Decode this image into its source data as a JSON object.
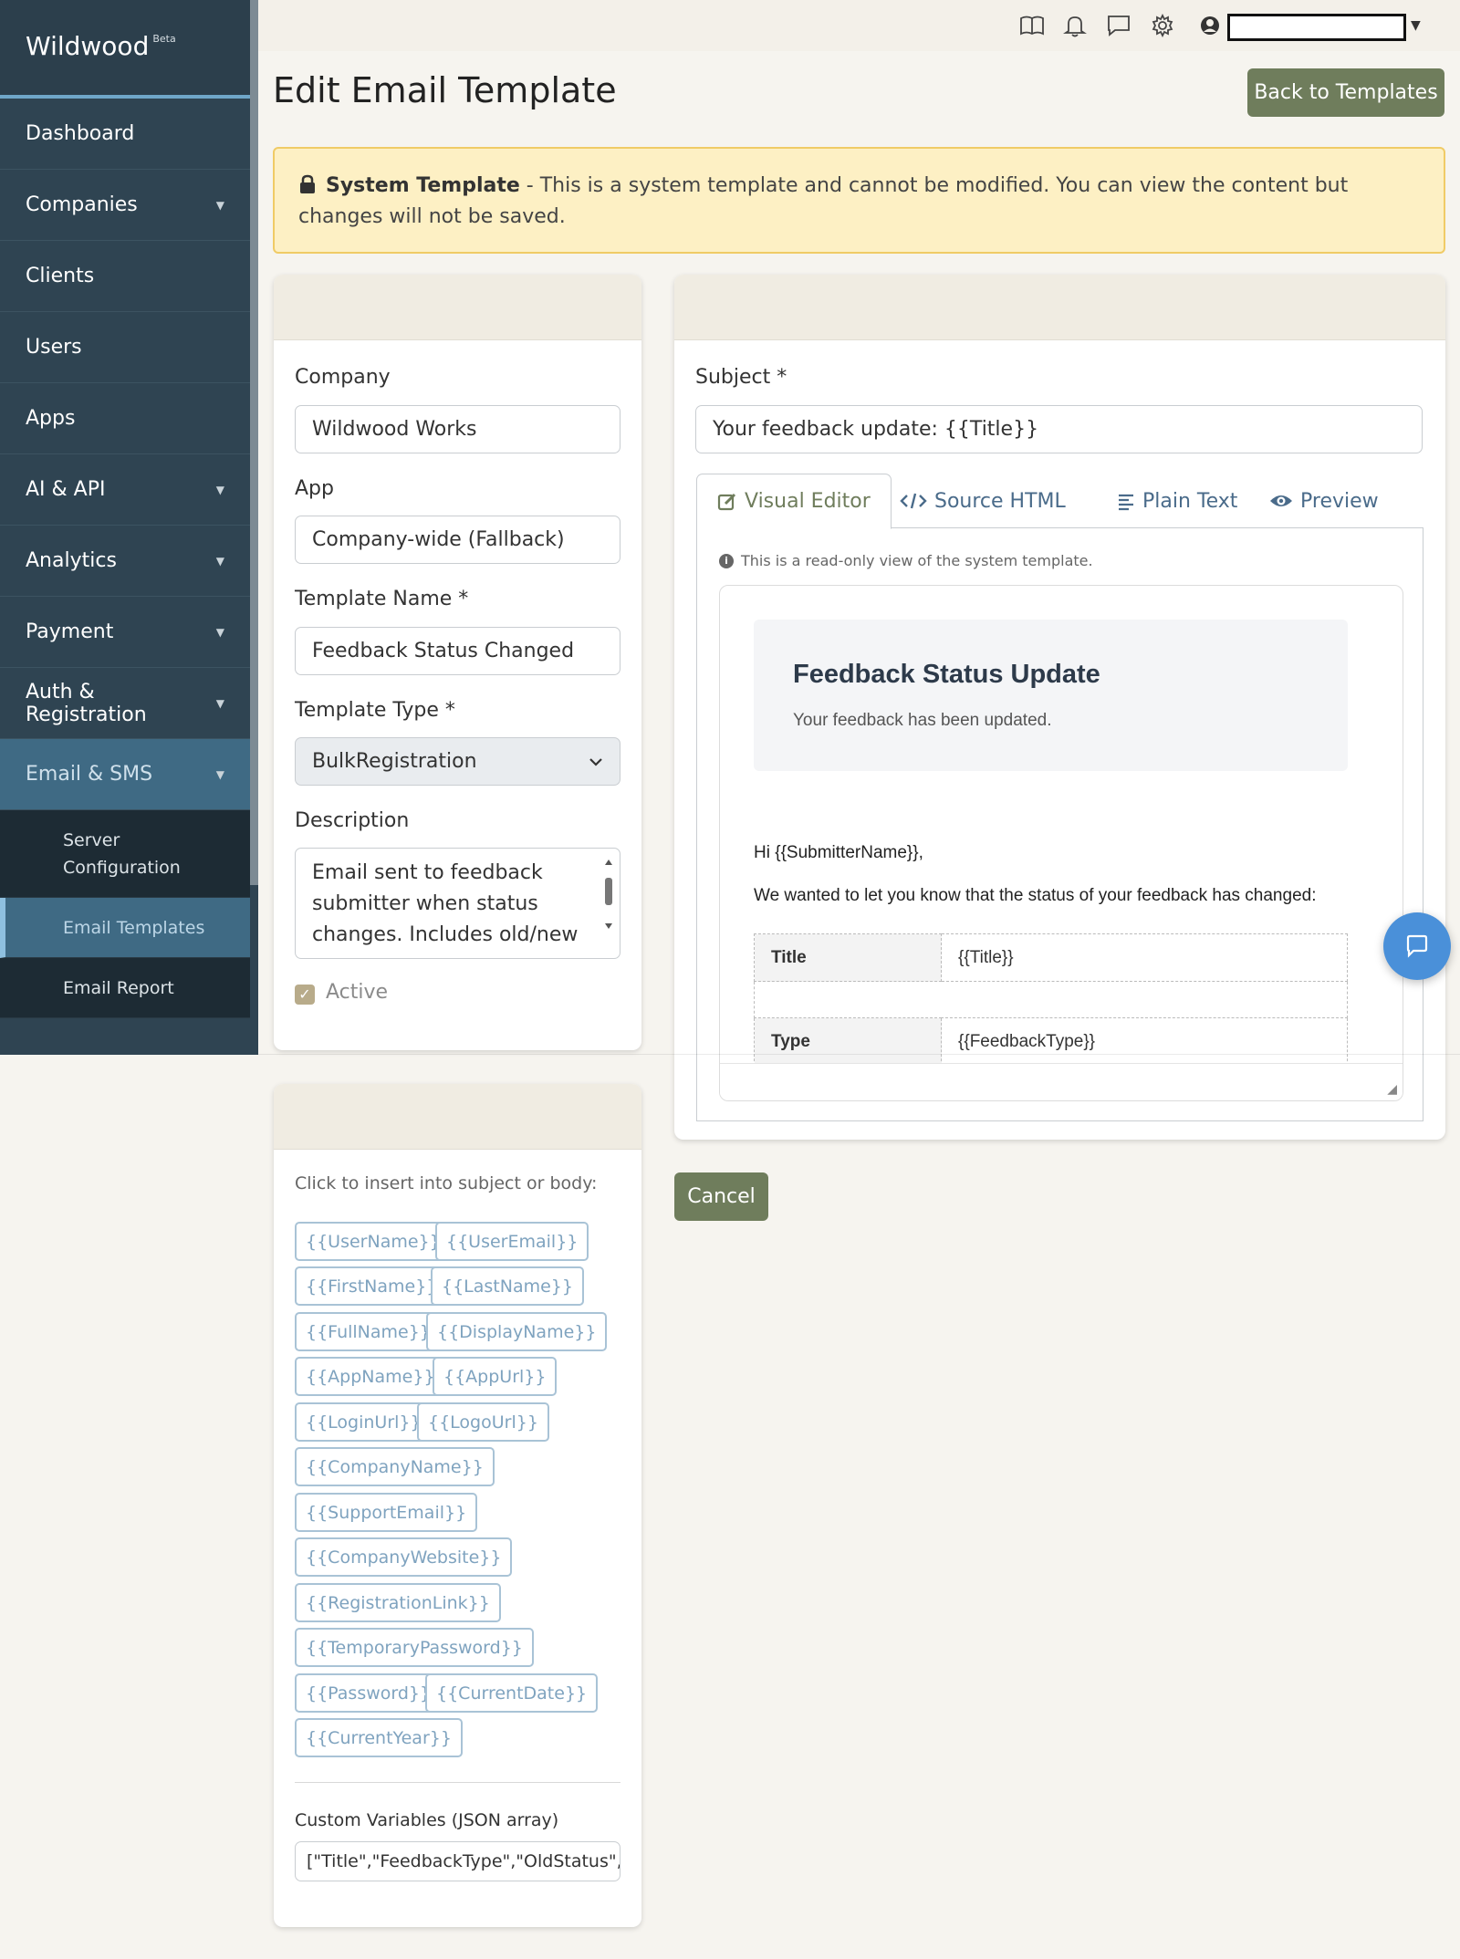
{
  "brand": {
    "name": "Wildwood",
    "badge": "Beta"
  },
  "sidebar": {
    "items": [
      {
        "label": "Dashboard",
        "has_caret": false
      },
      {
        "label": "Companies",
        "has_caret": true
      },
      {
        "label": "Clients",
        "has_caret": false
      },
      {
        "label": "Users",
        "has_caret": false
      },
      {
        "label": "Apps",
        "has_caret": false
      },
      {
        "label": "AI & API",
        "has_caret": true
      },
      {
        "label": "Analytics",
        "has_caret": true
      },
      {
        "label": "Payment",
        "has_caret": true
      },
      {
        "label": "Auth & Registration",
        "has_caret": true
      },
      {
        "label": "Email & SMS",
        "has_caret": true,
        "active": true
      }
    ],
    "subitems": [
      {
        "label": "Server Configuration"
      },
      {
        "label": "Email Templates",
        "active": true
      },
      {
        "label": "Email Report"
      }
    ]
  },
  "topbar": {
    "icons": [
      "book-icon",
      "bell-icon",
      "chat-icon",
      "gear-icon",
      "user-circle-icon"
    ],
    "user_name": ""
  },
  "page": {
    "title": "Edit Email Template",
    "back_button": "Back to Templates"
  },
  "alert": {
    "bold": "System Template",
    "text": " - This is a system template and cannot be modified. You can view the content but changes will not be saved."
  },
  "form": {
    "company_label": "Company",
    "company_value": "Wildwood Works",
    "app_label": "App",
    "app_value": "Company-wide (Fallback)",
    "name_label": "Template Name *",
    "name_value": "Feedback Status Changed",
    "type_label": "Template Type *",
    "type_value": "BulkRegistration",
    "description_label": "Description",
    "description_value": "Email sent to feedback submitter when status changes. Includes old/new",
    "active_label": "Active",
    "active_checked": true
  },
  "editor": {
    "subject_label": "Subject *",
    "subject_value": "Your feedback update: {{Title}}",
    "tabs": [
      "Visual Editor",
      "Source HTML",
      "Plain Text",
      "Preview"
    ],
    "active_tab": "Visual Editor",
    "readonly_note": "This is a read-only view of the system template.",
    "email": {
      "header_title": "Feedback Status Update",
      "header_subtitle": "Your feedback has been updated.",
      "greeting": "Hi {{SubmitterName}},",
      "intro": "We wanted to let you know that the status of your feedback has changed:",
      "rows": [
        {
          "key": "Title",
          "value": "{{Title}}"
        },
        {
          "key": "Type",
          "value": "{{FeedbackType}}"
        }
      ]
    },
    "cancel_button": "Cancel"
  },
  "variables": {
    "hint": "Click to insert into subject or body:",
    "chips": [
      "{{UserName}}",
      "{{UserEmail}}",
      "{{FirstName}}",
      "{{LastName}}",
      "{{FullName}}",
      "{{DisplayName}}",
      "{{AppName}}",
      "{{AppUrl}}",
      "{{LoginUrl}}",
      "{{LogoUrl}}",
      "{{CompanyName}}",
      "{{SupportEmail}}",
      "{{CompanyWebsite}}",
      "{{RegistrationLink}}",
      "{{TemporaryPassword}}",
      "{{Password}}",
      "{{CurrentDate}}",
      "{{CurrentYear}}"
    ],
    "custom_label": "Custom Variables (JSON array)",
    "custom_value": "[\"Title\",\"FeedbackType\",\"OldStatus\",\"N"
  },
  "colors": {
    "sidebar_bg": "#2f4452",
    "accent_green": "#6f7d5c",
    "active_nav": "#3f6a84",
    "link_blue": "#4a6b8a",
    "chat_blue": "#4a90d9"
  }
}
